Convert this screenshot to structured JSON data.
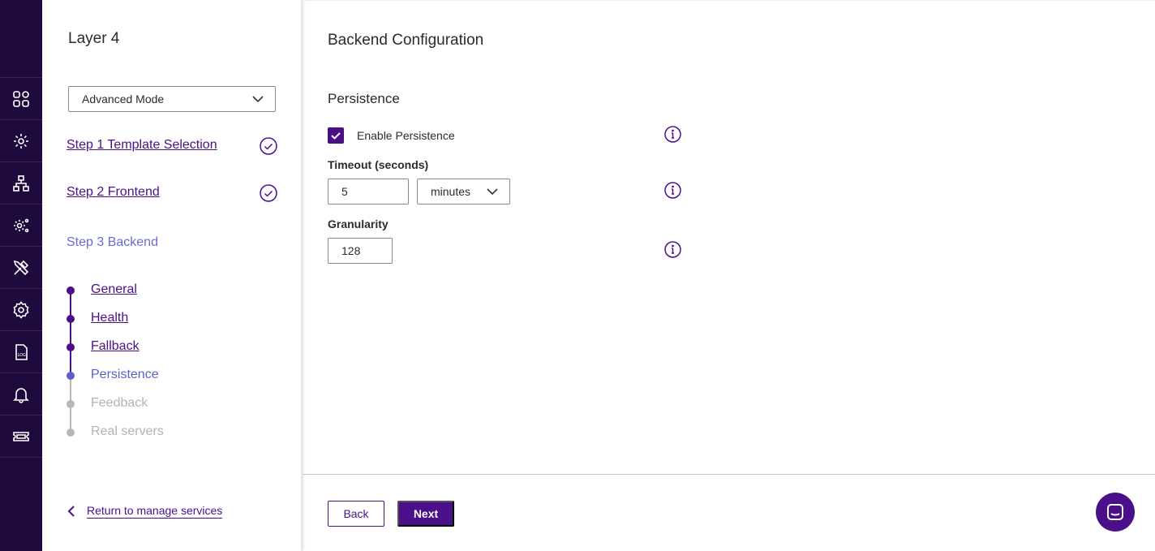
{
  "sidebar_rail": {
    "items": [
      {
        "icon": "apps-grid-icon"
      },
      {
        "icon": "services-icon"
      },
      {
        "icon": "network-icon"
      },
      {
        "icon": "system-config-icon"
      },
      {
        "icon": "tools-icon"
      },
      {
        "icon": "settings-icon"
      },
      {
        "icon": "log-file-icon"
      },
      {
        "icon": "notifications-bell-icon"
      },
      {
        "icon": "ticket-icon"
      }
    ],
    "log_icon_text": "LOG"
  },
  "steps_panel": {
    "title": "Layer 4",
    "mode_select": {
      "value": "Advanced Mode"
    },
    "steps": [
      {
        "label": "Step 1 Template Selection",
        "status": "complete"
      },
      {
        "label": "Step 2 Frontend",
        "status": "complete"
      },
      {
        "label": "Step 3 Backend",
        "status": "current"
      }
    ],
    "substeps": [
      {
        "label": "General",
        "status": "done"
      },
      {
        "label": "Health",
        "status": "done"
      },
      {
        "label": "Fallback",
        "status": "done"
      },
      {
        "label": "Persistence",
        "status": "active"
      },
      {
        "label": "Feedback",
        "status": "todo"
      },
      {
        "label": "Real servers",
        "status": "todo"
      }
    ],
    "return_link": "Return to manage services"
  },
  "main": {
    "title": "Backend Configuration",
    "section_title": "Persistence",
    "enable_persistence": {
      "label": "Enable Persistence",
      "checked": true
    },
    "timeout": {
      "label": "Timeout (seconds)",
      "value": "5",
      "unit": "minutes"
    },
    "granularity": {
      "label": "Granularity",
      "value": "128"
    },
    "buttons": {
      "back": "Back",
      "next": "Next"
    }
  },
  "colors": {
    "rail_bg": "#1e0a3c",
    "accent": "#4b0f8a",
    "active_step": "#5b5fc7",
    "inactive": "#b3b3b3"
  }
}
